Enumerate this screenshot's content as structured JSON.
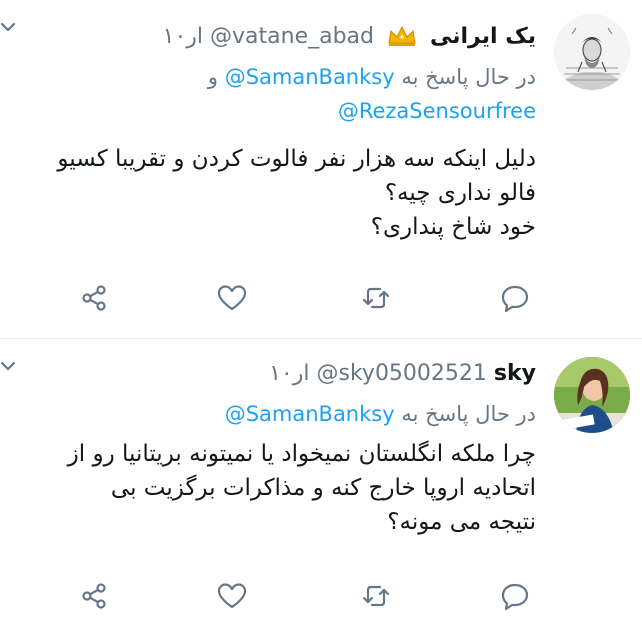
{
  "tweets": [
    {
      "display_name": "یک ایرانی",
      "handle": "@vatane_abad",
      "time": "۱۰ار",
      "replying_prefix": "در حال پاسخ به",
      "replying_to": [
        "@SamanBanksy",
        "@RezaSensourfree"
      ],
      "replying_joiner": "و",
      "body_lines": [
        "دلیل اینکه سه هزار نفر فالوت کردن و تقریبا کسیو",
        "فالو نداری چیه؟",
        "خود شاخ پنداری؟"
      ],
      "badge_icon": "crown-icon"
    },
    {
      "display_name": "sky",
      "handle": "@sky05002521",
      "time": "۱۰ار",
      "replying_prefix": "در حال پاسخ به",
      "replying_to": [
        "@SamanBanksy"
      ],
      "body_lines": [
        "چرا ملکه انگلستان نمیخواد یا نمیتونه بریتانیا رو از",
        "اتحادیه اروپا خارج کنه و مذاکرات برگزیت بی",
        "نتیجه می مونه؟"
      ]
    }
  ],
  "icons": {
    "actions": [
      "share-icon",
      "like-icon",
      "retweet-icon",
      "reply-icon"
    ],
    "menu": "chevron-down-icon"
  },
  "colors": {
    "link": "#1da1f2",
    "secondary_text": "#657786",
    "primary_text": "#14171a",
    "divider": "#e6ecf0",
    "crown": "#f5b400"
  }
}
